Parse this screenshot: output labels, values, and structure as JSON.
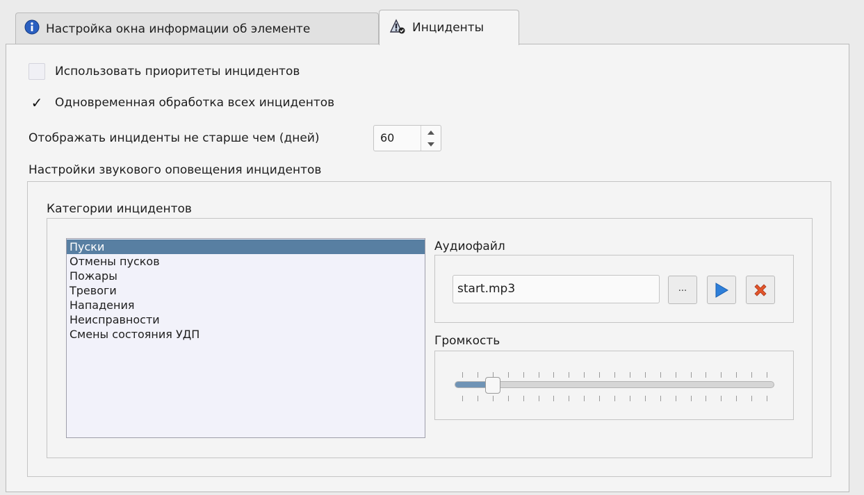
{
  "tabs": {
    "info_window": {
      "label": "Настройка окна информации об элементе",
      "icon": "info-icon"
    },
    "incidents": {
      "label": "Инциденты",
      "icon": "incident-bell-icon",
      "active": true
    }
  },
  "options": {
    "use_priorities": {
      "label": "Использовать приоритеты инцидентов",
      "checked": false
    },
    "simultaneous": {
      "label": "Одновременная обработка всех инцидентов",
      "checked": true,
      "mark": "✓"
    }
  },
  "days_filter": {
    "label": "Отображать инциденты не старше чем (дней)",
    "value": "60"
  },
  "sound": {
    "group_title": "Настройки звукового оповещения инцидентов",
    "categories_title": "Категории инцидентов",
    "categories": [
      "Пуски",
      "Отмены пусков",
      "Пожары",
      "Тревоги",
      "Нападения",
      "Неисправности",
      "Смены состояния УДП"
    ],
    "selected_index": 0,
    "audiofile_label": "Аудиофайл",
    "audiofile_value": "start.mp3",
    "browse_label": "...",
    "volume_label": "Громкость",
    "volume_fraction": 0.1
  },
  "colors": {
    "selection": "#587fa2",
    "play": "#2e7fd9",
    "remove": "#e2552a"
  }
}
